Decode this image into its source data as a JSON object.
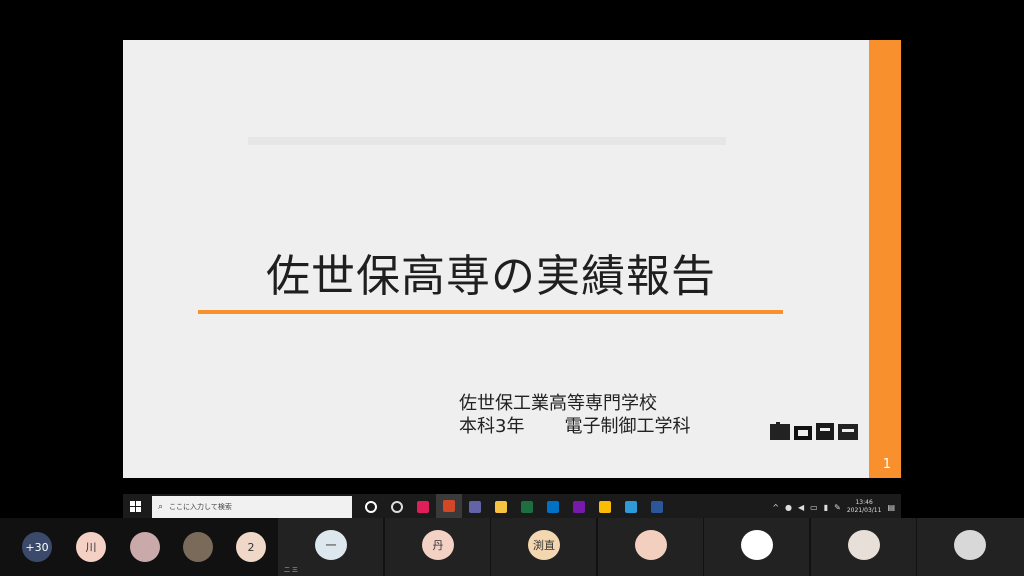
{
  "slide": {
    "title": "佐世保高専の実績報告",
    "school_line1": "佐世保工業高等専門学校",
    "school_line2_a": "本科3年",
    "school_line2_b": "電子制御工学科",
    "page_number": "1",
    "accent_color": "#f7902d"
  },
  "taskbar": {
    "search_placeholder": "ここに入力して検索",
    "apps": [
      {
        "icon": "cortana-icon",
        "color": "#ffffff"
      },
      {
        "icon": "task-view-icon",
        "color": "#dddddd"
      },
      {
        "icon": "slack-icon",
        "color": "#e01e5a"
      },
      {
        "icon": "powerpoint-icon",
        "color": "#d24726"
      },
      {
        "icon": "teams-icon",
        "color": "#6264a7"
      },
      {
        "icon": "file-explorer-icon",
        "color": "#f6c343"
      },
      {
        "icon": "excel-icon",
        "color": "#1d6f42"
      },
      {
        "icon": "outlook-icon",
        "color": "#0072c6"
      },
      {
        "icon": "onenote-icon",
        "color": "#7719aa"
      },
      {
        "icon": "chrome-icon",
        "color": "#fbbc05"
      },
      {
        "icon": "edge-icon",
        "color": "#2e9ad8"
      },
      {
        "icon": "word-icon",
        "color": "#2b579a"
      }
    ],
    "time": "13:46",
    "date": "2021/03/11"
  },
  "participants": {
    "more_count": "+30",
    "circles": [
      {
        "text": "川",
        "bg": "#f5d0c5"
      },
      {
        "text": "",
        "bg": "#c9a9a9"
      },
      {
        "text": "",
        "bg": "#7a6a5a"
      },
      {
        "text": "2",
        "bg": "#f0d8c8"
      }
    ],
    "tiles": [
      {
        "initial": "一",
        "bg": "#dde8ee",
        "name": "二 三"
      },
      {
        "initial": "丹",
        "bg": "#f3d1c4",
        "name": ""
      },
      {
        "initial": "渕直",
        "bg": "#f3d7b0",
        "name": ""
      },
      {
        "initial": "",
        "bg": "#f3cfc0",
        "name": ""
      },
      {
        "initial": "",
        "bg": "#ffffff",
        "name": ""
      },
      {
        "initial": "",
        "bg": "#e8e0d8",
        "name": ""
      },
      {
        "initial": "",
        "bg": "#d8d8d8",
        "name": ""
      }
    ]
  }
}
